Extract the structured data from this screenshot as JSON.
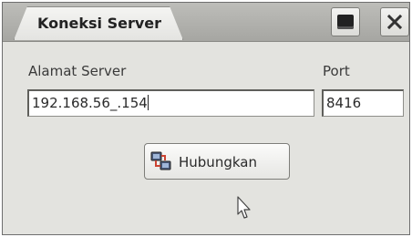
{
  "window": {
    "title": "Koneksi Server",
    "maximize_icon": "maximize-icon",
    "close_icon": "close-icon"
  },
  "form": {
    "server_label": "Alamat Server",
    "server_value": "192.168.56_.154",
    "port_label": "Port",
    "port_value": "8416"
  },
  "actions": {
    "connect_label": "Hubungkan",
    "connect_icon": "network-connect-icon"
  },
  "pointer": {
    "icon": "mouse-pointer-icon"
  }
}
